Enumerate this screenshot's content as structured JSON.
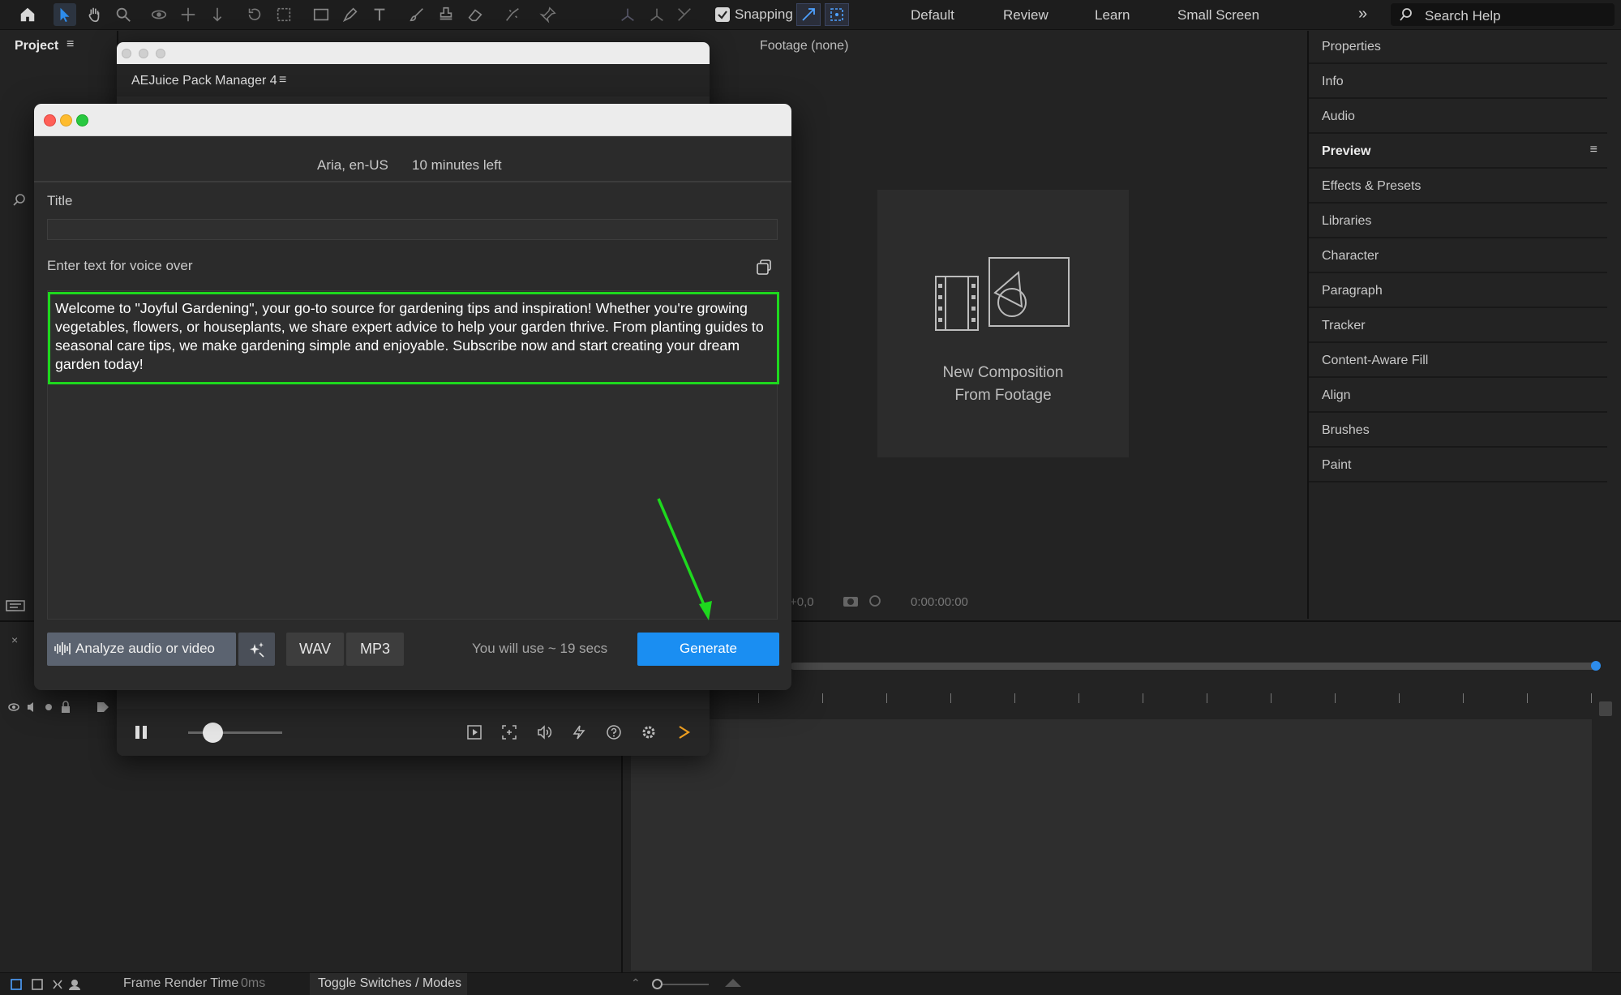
{
  "toolbar": {
    "snapping_label": "Snapping",
    "workspaces": [
      "Default",
      "Review",
      "Learn",
      "Small Screen"
    ],
    "more_glyph": "»",
    "search_placeholder": "Search Help"
  },
  "project_panel": {
    "title": "Project",
    "menu_glyph": "≡"
  },
  "viewer": {
    "title": "Footage (none)",
    "new_comp_line1": "New Composition",
    "new_comp_line2": "From Footage",
    "timecode": "0:00:00:00",
    "offset": "+0,0"
  },
  "right_panels": {
    "items": [
      {
        "label": "Properties"
      },
      {
        "label": "Info"
      },
      {
        "label": "Audio"
      },
      {
        "label": "Preview"
      },
      {
        "label": "Effects & Presets"
      },
      {
        "label": "Libraries"
      },
      {
        "label": "Character"
      },
      {
        "label": "Paragraph"
      },
      {
        "label": "Tracker"
      },
      {
        "label": "Content-Aware Fill"
      },
      {
        "label": "Align"
      },
      {
        "label": "Brushes"
      },
      {
        "label": "Paint"
      }
    ],
    "active": "Preview"
  },
  "aejuice": {
    "tab_title": "AEJuice Pack Manager 4",
    "menu_glyph": "≡"
  },
  "voice_over": {
    "voice": "Aria, en-US",
    "time_left": "10 minutes left",
    "title_label": "Title",
    "title_value": "",
    "text_label": "Enter text for voice over",
    "text_value": "Welcome to \"Joyful Gardening\", your go-to source for gardening tips and inspiration! Whether you're growing vegetables, flowers, or houseplants, we share expert advice to help your garden thrive. From planting guides to seasonal care tips, we make gardening simple and enjoyable. Subscribe now and start creating your dream garden today!",
    "analyze_label": "Analyze audio or video",
    "wav_label": "WAV",
    "mp3_label": "MP3",
    "usage_text": "You will use ~ 19 secs",
    "generate_label": "Generate"
  },
  "statusbar": {
    "frame_render_label": "Frame Render Time",
    "frame_render_value": "0ms",
    "toggle_label": "Toggle Switches / Modes"
  },
  "colors": {
    "accent_blue": "#1a8ef2",
    "highlight_green": "#1ed81e",
    "close_red": "#ff5f57",
    "minimize_yellow": "#febc2e",
    "zoom_green": "#28c840"
  }
}
